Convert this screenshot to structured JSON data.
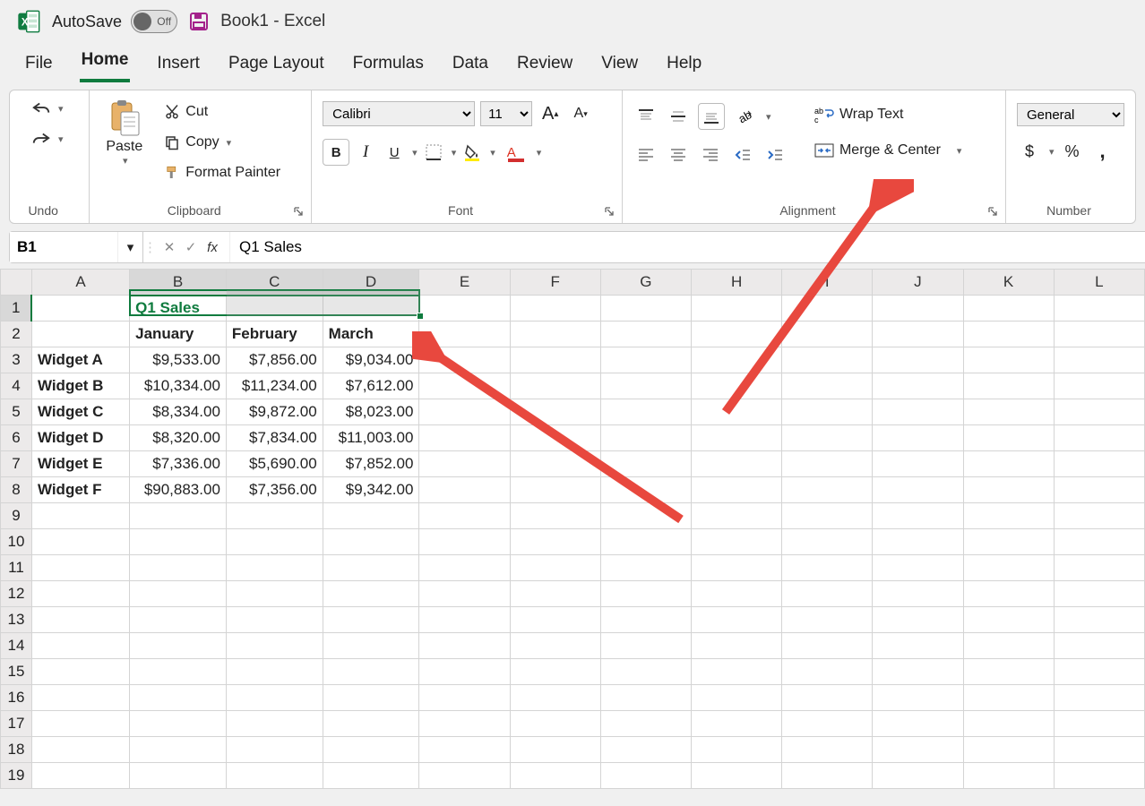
{
  "titlebar": {
    "autosave_label": "AutoSave",
    "autosave_state": "Off",
    "document_title": "Book1  -  Excel"
  },
  "tabs": [
    "File",
    "Home",
    "Insert",
    "Page Layout",
    "Formulas",
    "Data",
    "Review",
    "View",
    "Help"
  ],
  "active_tab": "Home",
  "ribbon": {
    "undo_label": "Undo",
    "paste_label": "Paste",
    "cut_label": "Cut",
    "copy_label": "Copy",
    "format_painter_label": "Format Painter",
    "clipboard_label": "Clipboard",
    "font_name": "Calibri",
    "font_size": "11",
    "font_label": "Font",
    "wrap_text_label": "Wrap Text",
    "merge_center_label": "Merge & Center",
    "alignment_label": "Alignment",
    "number_format": "General",
    "number_label": "Number"
  },
  "formula_bar": {
    "name_box": "B1",
    "formula": "Q1 Sales"
  },
  "sheet": {
    "columns": [
      "A",
      "B",
      "C",
      "D",
      "E",
      "F",
      "G",
      "H",
      "I",
      "J",
      "K",
      "L"
    ],
    "row_count": 19,
    "selected_cols": [
      "B",
      "C",
      "D"
    ],
    "selected_row": 1,
    "data": {
      "B1": "Q1 Sales",
      "B2": "January",
      "C2": "February",
      "D2": "March",
      "A3": "Widget A",
      "B3": "$9,533.00",
      "C3": "$7,856.00",
      "D3": "$9,034.00",
      "A4": "Widget B",
      "B4": "$10,334.00",
      "C4": "$11,234.00",
      "D4": "$7,612.00",
      "A5": "Widget C",
      "B5": "$8,334.00",
      "C5": "$9,872.00",
      "D5": "$8,023.00",
      "A6": "Widget D",
      "B6": "$8,320.00",
      "C6": "$7,834.00",
      "D6": "$11,003.00",
      "A7": "Widget E",
      "B7": "$7,336.00",
      "C7": "$5,690.00",
      "D7": "$7,852.00",
      "A8": "Widget F",
      "B8": "$90,883.00",
      "C8": "$7,356.00",
      "D8": "$9,342.00"
    }
  }
}
